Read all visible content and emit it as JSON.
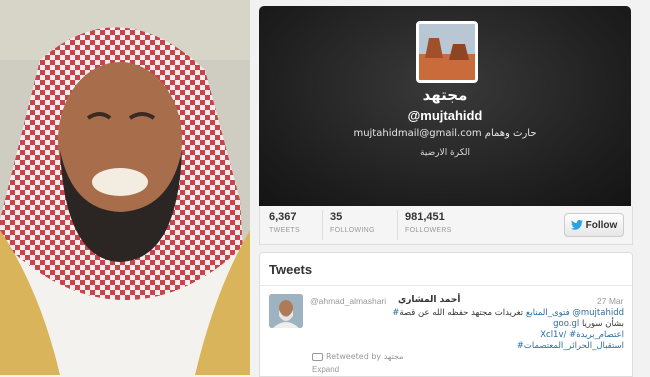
{
  "profile": {
    "display_name": "مجتهد",
    "handle": "@mujtahidd",
    "bio": "mujtahidmail@gmail.com حارث وهمام",
    "location": "الكرة الارضية"
  },
  "stats": [
    {
      "value": "6,367",
      "label": "TWEETS"
    },
    {
      "value": "35",
      "label": "FOLLOWING"
    },
    {
      "value": "981,451",
      "label": "FOLLOWERS"
    }
  ],
  "follow_label": "Follow",
  "tweets_heading": "Tweets",
  "tweet": {
    "author_name": "أحمد المشاري",
    "author_handle": "@ahmad_almashari",
    "time": "27 Mar",
    "line1_handle": "@mujtahidd",
    "line1_text": "تغريدات مجتهد حفظه الله عن قصة",
    "line1_tag": "#فتوى_المنابع",
    "line2_text": "بشأن سوريا",
    "line2_link": "goo.gl",
    "line3": "Xcl1v/ #اعتصام_بريدة",
    "line4": "#استقبال_الحرائر_المعتصمات",
    "retweeted_by": "Retweeted by مجتهد",
    "expand": "Expand"
  },
  "colors": {
    "link": "#2a6da0",
    "header_bg": "#1e1e1e",
    "twitter_blue": "#2ba2e2"
  }
}
